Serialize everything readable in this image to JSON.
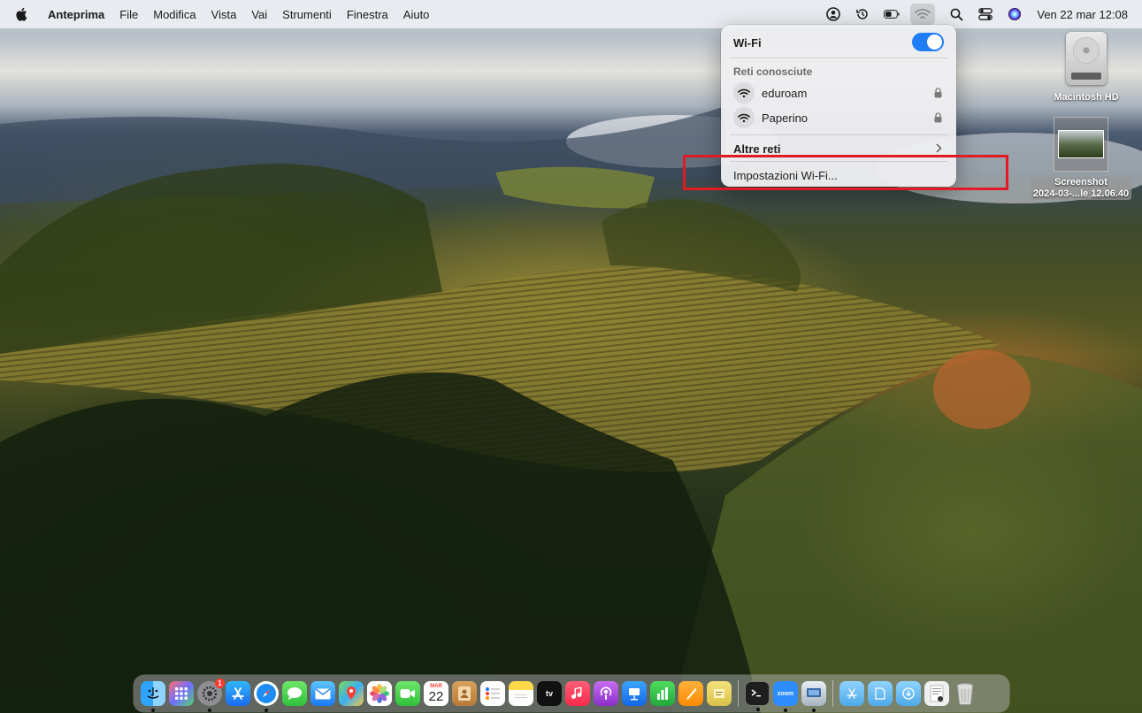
{
  "menubar": {
    "app_name": "Anteprima",
    "menus": [
      "File",
      "Modifica",
      "Vista",
      "Vai",
      "Strumenti",
      "Finestra",
      "Aiuto"
    ],
    "clock": "Ven 22 mar  12:08"
  },
  "wifi_menu": {
    "title": "Wi-Fi",
    "toggle_on": true,
    "known_header": "Reti conosciute",
    "networks": [
      {
        "name": "eduroam",
        "locked": true
      },
      {
        "name": "Paperino",
        "locked": true
      }
    ],
    "other_networks": "Altre reti",
    "settings": "Impostazioni Wi-Fi..."
  },
  "desktop": {
    "drive_label": "Macintosh HD",
    "screenshot_label_1": "Screenshot",
    "screenshot_label_2": "2024-03-...le 12.06.40"
  },
  "dock": {
    "calendar_month": "MAR",
    "calendar_day": "22",
    "settings_badge": "1",
    "tv_label": "tv",
    "zoom_label": "zoom"
  },
  "colors": {
    "highlight": "#e21b23",
    "toggle": "#1f7df6"
  }
}
